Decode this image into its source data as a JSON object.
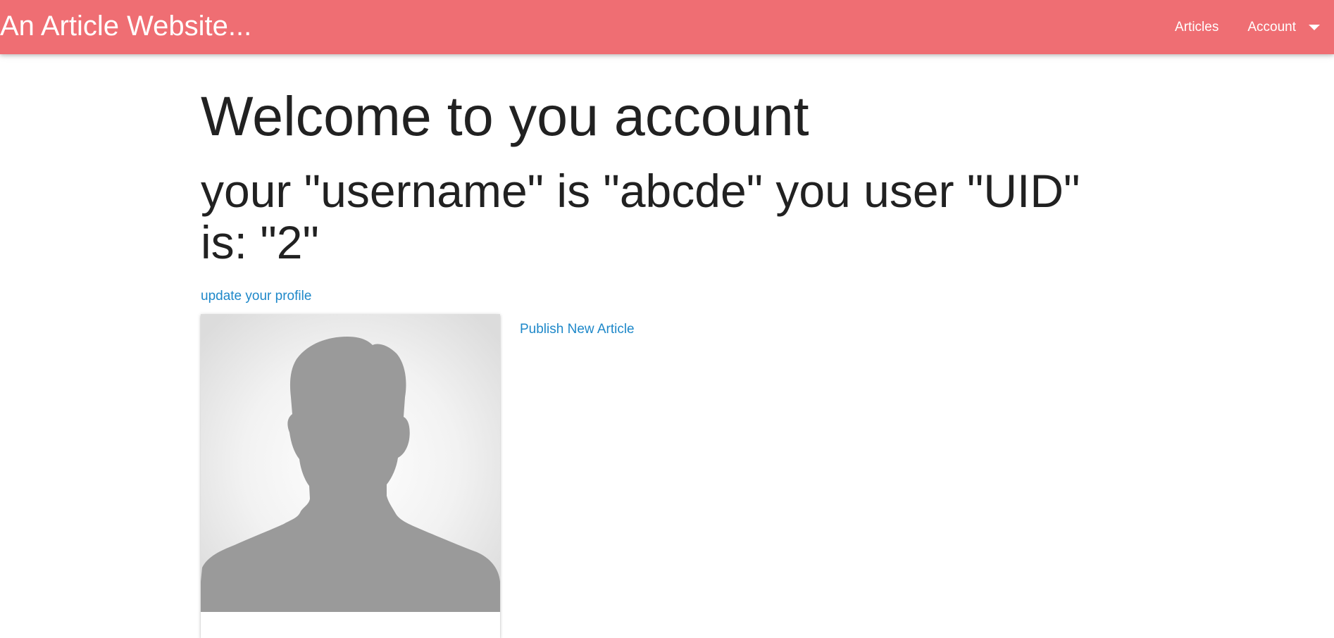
{
  "navbar": {
    "brand": "An Article Website...",
    "links": [
      {
        "label": "Articles"
      },
      {
        "label": "Account"
      }
    ],
    "icons": {
      "dropdown": "caret-down-icon"
    },
    "background_color": "#ef6e73"
  },
  "main": {
    "heading": "Welcome to you account",
    "user_info": "your \"username\" is \"abcde\" you user \"UID\" is: \"2\"",
    "update_profile_link": "update your profile",
    "publish_link": "Publish New Article",
    "avatar": {
      "icon": "default-avatar-silhouette-icon"
    },
    "link_color": "#1e88c9"
  }
}
